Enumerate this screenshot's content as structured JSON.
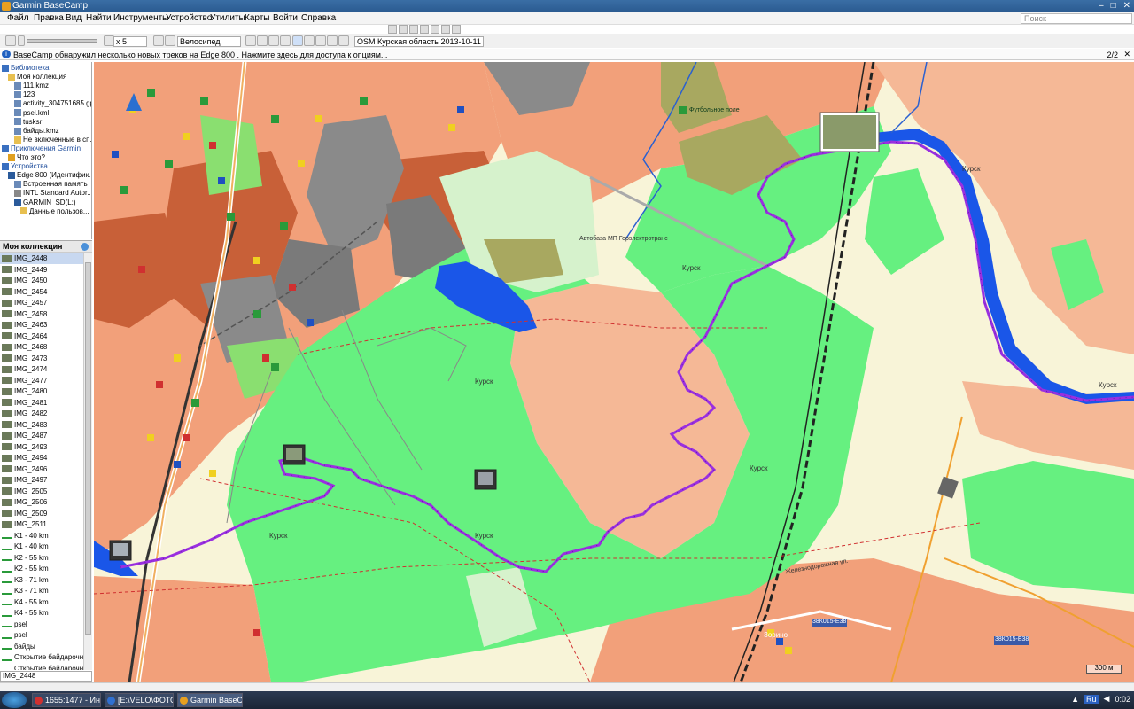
{
  "window": {
    "title": "Garmin BaseCamp",
    "controls": [
      "–",
      "□",
      "✕"
    ]
  },
  "menu": {
    "items": [
      "Файл",
      "Правка",
      "Вид",
      "Найти",
      "Инструменты",
      "Устройство",
      "Утилиты",
      "Карты",
      "Войти",
      "Справка"
    ],
    "search_placeholder": "Поиск"
  },
  "toolbar": {
    "speed": "x 5",
    "profile": "Велосипед",
    "map_product": "OSM Курская область 2013-10-11"
  },
  "infobar": {
    "message": "BaseCamp обнаружил несколько новых треков на Edge 800 . Нажмите здесь для доступа к опциям...",
    "page": "2/2",
    "close": "✕"
  },
  "library": {
    "items": [
      {
        "label": "Библиотека",
        "level": 0,
        "type": "header"
      },
      {
        "label": "Моя коллекция",
        "level": 1,
        "type": "folder"
      },
      {
        "label": "111.kmz",
        "level": 2,
        "type": "file"
      },
      {
        "label": "123",
        "level": 2,
        "type": "file"
      },
      {
        "label": "activity_304751685.gpx",
        "level": 2,
        "type": "file"
      },
      {
        "label": "psel.kml",
        "level": 2,
        "type": "file"
      },
      {
        "label": "tusksr",
        "level": 2,
        "type": "file"
      },
      {
        "label": "байды.kmz",
        "level": 2,
        "type": "file"
      },
      {
        "label": "Не включенные в сп...",
        "level": 2,
        "type": "folder"
      },
      {
        "label": "Приключения Garmin",
        "level": 0,
        "type": "header"
      },
      {
        "label": "Что это?",
        "level": 1,
        "type": "help"
      },
      {
        "label": "Устройства",
        "level": 0,
        "type": "header"
      },
      {
        "label": "Edge 800 (Идентифик...",
        "level": 1,
        "type": "device"
      },
      {
        "label": "Встроенная память",
        "level": 2,
        "type": "file"
      },
      {
        "label": "INTL Standard Autor...",
        "level": 2,
        "type": "map"
      },
      {
        "label": "GARMIN_SD(L:)",
        "level": 2,
        "type": "device"
      },
      {
        "label": "Данные пользов...",
        "level": 3,
        "type": "folder"
      }
    ]
  },
  "collection": {
    "title": "Моя коллекция",
    "rows": [
      {
        "label": "IMG_2448",
        "kind": "photo"
      },
      {
        "label": "IMG_2449",
        "kind": "photo"
      },
      {
        "label": "IMG_2450",
        "kind": "photo"
      },
      {
        "label": "IMG_2454",
        "kind": "photo"
      },
      {
        "label": "IMG_2457",
        "kind": "photo"
      },
      {
        "label": "IMG_2458",
        "kind": "photo"
      },
      {
        "label": "IMG_2463",
        "kind": "photo"
      },
      {
        "label": "IMG_2464",
        "kind": "photo"
      },
      {
        "label": "IMG_2468",
        "kind": "photo"
      },
      {
        "label": "IMG_2473",
        "kind": "photo"
      },
      {
        "label": "IMG_2474",
        "kind": "photo"
      },
      {
        "label": "IMG_2477",
        "kind": "photo"
      },
      {
        "label": "IMG_2480",
        "kind": "photo"
      },
      {
        "label": "IMG_2481",
        "kind": "photo"
      },
      {
        "label": "IMG_2482",
        "kind": "photo"
      },
      {
        "label": "IMG_2483",
        "kind": "photo"
      },
      {
        "label": "IMG_2487",
        "kind": "photo"
      },
      {
        "label": "IMG_2493",
        "kind": "photo"
      },
      {
        "label": "IMG_2494",
        "kind": "photo"
      },
      {
        "label": "IMG_2496",
        "kind": "photo"
      },
      {
        "label": "IMG_2497",
        "kind": "photo"
      },
      {
        "label": "IMG_2505",
        "kind": "photo"
      },
      {
        "label": "IMG_2506",
        "kind": "photo"
      },
      {
        "label": "IMG_2509",
        "kind": "photo"
      },
      {
        "label": "IMG_2511",
        "kind": "photo"
      },
      {
        "label": "K1 - 40 km",
        "kind": "track"
      },
      {
        "label": "K1 - 40 km",
        "kind": "track"
      },
      {
        "label": "K2 - 55 km",
        "kind": "track"
      },
      {
        "label": "K2 - 55 km",
        "kind": "track"
      },
      {
        "label": "K3 - 71 km",
        "kind": "track"
      },
      {
        "label": "K3 - 71 km",
        "kind": "track"
      },
      {
        "label": "K4 - 55 km",
        "kind": "track"
      },
      {
        "label": "K4 - 55 km",
        "kind": "track"
      },
      {
        "label": "psel",
        "kind": "track"
      },
      {
        "label": "psel",
        "kind": "track"
      },
      {
        "label": "байды",
        "kind": "track"
      },
      {
        "label": "Открытие байдарочног",
        "kind": "track"
      },
      {
        "label": "Открытие байдарочног",
        "kind": "track"
      }
    ],
    "selected_value": "IMG_2448"
  },
  "map": {
    "labels": [
      {
        "text": "Курск",
        "id": "kursk-1"
      },
      {
        "text": "Курск",
        "id": "kursk-2"
      },
      {
        "text": "Курск",
        "id": "kursk-3"
      },
      {
        "text": "Курск",
        "id": "kursk-4"
      },
      {
        "text": "Курск",
        "id": "kursk-5"
      },
      {
        "text": "Курск",
        "id": "kursk-6"
      },
      {
        "text": "Курск",
        "id": "kursk-7"
      },
      {
        "text": "Футбольное поле",
        "id": "football"
      },
      {
        "text": "Автобаза МП Горэлектротранс",
        "id": "autobase"
      },
      {
        "text": "Зорино",
        "id": "zorino"
      },
      {
        "text": "Железнодорожная ул.",
        "id": "zhd-st"
      },
      {
        "text": "38К015-Е38",
        "id": "road-1"
      },
      {
        "text": "38К015-Е38",
        "id": "road-2"
      }
    ],
    "scale": "300 м",
    "colors": {
      "water": "#1a56e8",
      "track": "#9a2fe0",
      "forest": "#66f080",
      "urban": "#f2a07a",
      "industrial": "#c86038",
      "grey": "#7a7a7a",
      "rail": "#222222"
    }
  },
  "taskbar": {
    "tasks": [
      {
        "label": "1655:1477 - Инт...",
        "color": "#d03030"
      },
      {
        "label": "[E:\\VELO\\ФОТО...",
        "color": "#3070d0"
      },
      {
        "label": "Garmin BaseCa...",
        "color": "#e8a020"
      }
    ],
    "lang": "Ru",
    "clock": "0:02"
  }
}
